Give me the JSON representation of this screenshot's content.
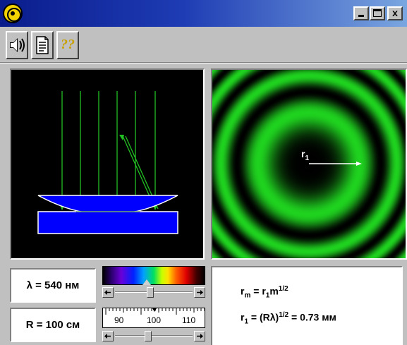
{
  "titlebar": {
    "minimize_label": "_",
    "close_label": "x",
    "app_icon": "rings-icon"
  },
  "toolbar": {
    "sound_icon": "speaker-icon",
    "doc_icon": "document-icon",
    "help_icon": "help-icon",
    "help_label": "?"
  },
  "params": {
    "wavelength_text": "λ = 540 нм",
    "radius_text": "R = 100 см",
    "wavelength_slider_fraction": 0.45,
    "radius_slider_fraction": 0.42
  },
  "ruler": {
    "labels": [
      "90",
      "100",
      "110"
    ]
  },
  "rings_view": {
    "radius_label": "r",
    "radius_sub": "1",
    "ring_color": "#1fd21f"
  },
  "formulas": {
    "line1": {
      "r": "r",
      "sub_m": "m",
      "eq": " = ",
      "r1": "r",
      "sub_1": "1",
      "m": "m",
      "sup": "1/2"
    },
    "line2": {
      "r1": "r",
      "sub_1": "1",
      "eq": " = (Rλ)",
      "sup": "1/2",
      "tail": " = 0.73 мм"
    }
  },
  "colors": {
    "lens_blue": "#0000ff",
    "ray_green": "#22c022",
    "title_blue": "#0a1c8c"
  }
}
